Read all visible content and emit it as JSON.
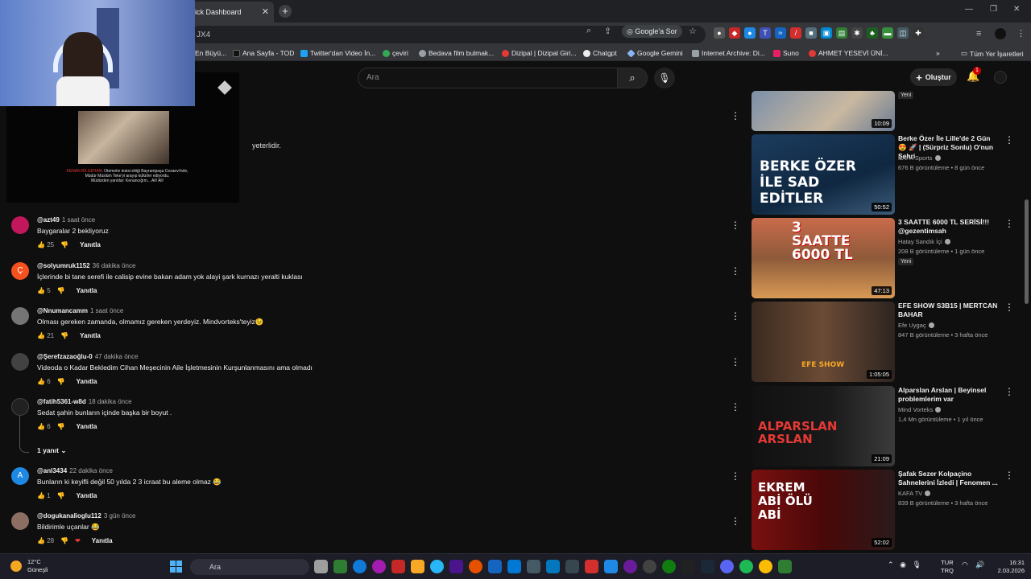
{
  "browser": {
    "tab_title": "ick Dashboard",
    "address": "JX4",
    "ask_google": "Google'a Sor",
    "bookmarks": [
      {
        "label": "En Büyü...",
        "color": "#4285f4"
      },
      {
        "label": "Ana Sayfa - TOD",
        "color": "#111111"
      },
      {
        "label": "Twitter'dan Video İn...",
        "color": "#1da1f2"
      },
      {
        "label": "çeviri",
        "color": "#34a853"
      },
      {
        "label": "Bedava film bulmak...",
        "color": "#9aa0a6"
      },
      {
        "label": "Dizipal | Dizipal Giri...",
        "color": "#e53935"
      },
      {
        "label": "Chatgpt",
        "color": "#ffffff"
      },
      {
        "label": "Google Gemini",
        "color": "#8ab4f8"
      },
      {
        "label": "Internet Archive: Di...",
        "color": "#9aa0a6"
      },
      {
        "label": "Suno",
        "color": "#e91e63"
      },
      {
        "label": "AHMET YESEVİ ÜNİ...",
        "color": "#e53935"
      }
    ],
    "all_bookmarks": "Tüm Yer İşaretleri"
  },
  "youtube": {
    "search_placeholder": "Ara",
    "create_label": "Oluştur",
    "notification_count": "1",
    "peek_text": "yeterlidir."
  },
  "mini_player": {
    "subtitle_name": "KENAN BİLGEHAN",
    "subtitle_line1": ": Otomotiv tesisi ettiği Bayrampaşa Cezaevi'nde,",
    "subtitle_line2": "Müdür Müslüm Teke'yi arayıp küfürler ediyordu.",
    "subtitle_line3": "Müdürden yanıtlar: Kenancığım... Ali! Ali!"
  },
  "comments": [
    {
      "author": "@azt49",
      "time": "1 saat önce",
      "text": "Baygaralar 2 bekliyoruz",
      "likes": "25",
      "avatar": "#c2185b",
      "initial": ""
    },
    {
      "author": "@solyumruk1152",
      "time": "36 dakika önce",
      "text": "İçlerinde bi tane serefi ile calisip evine bakan adam yok alayi şark kurnazı yeralti kuklası",
      "likes": "5",
      "avatar": "#f4511e",
      "initial": "Ç"
    },
    {
      "author": "@Nnumancamm",
      "time": "1 saat önce",
      "text": "Olması gereken zamanda, olmamız gereken yerdeyiz. Mindvorteks'teyiz😉",
      "likes": "21",
      "avatar": "#757575",
      "initial": ""
    },
    {
      "author": "@Şerefzazaoğlu-0",
      "time": "47 dakika önce",
      "text": "Videoda o Kadar Bekledim Cihan Meşecinin Aile İşletmesinin Kurşunlanmasını ama olmadı",
      "likes": "6",
      "avatar": "#424242",
      "initial": ""
    },
    {
      "author": "@fatih5361-w8d",
      "time": "18 dakika önce",
      "text": "Sedat şahin bunların içinde başka bir boyut .",
      "likes": "6",
      "avatar": "#212121",
      "initial": ""
    },
    {
      "author": "@anl3434",
      "time": "22 dakika önce",
      "text": "Bunların ki keyifli değil 50 yılda 2 3 icraat bu aleme olmaz 😂",
      "likes": "1",
      "avatar": "#1e88e5",
      "initial": "A"
    },
    {
      "author": "@dogukanalioglu112",
      "time": "3 gün önce",
      "text": "Bildirimle uçanlar 😂",
      "likes": "28",
      "avatar": "#8d6e63",
      "initial": ""
    }
  ],
  "replies_toggle": "1 yanıt",
  "reply_label": "Yanıtla",
  "recommendations": [
    {
      "title": "",
      "channel": "",
      "meta": "",
      "duration": "10:09",
      "badge": "Yeni"
    },
    {
      "title": "Berke Özer İle Lille'de 2 Gün 😍 🚀 | (Sürpriz Sonlu) O'nun Şehri",
      "channel": "KAFA Sports",
      "meta": "676 B görüntüleme • 8 gün önce",
      "duration": "50:52",
      "badge": "",
      "thumb_text": "BERKE ÖZER İLE SAD EDİTLER"
    },
    {
      "title": "3 SAATTE 6000 TL SERİSİ!!! @gezentimsah",
      "channel": "Hatay Sandık İçi",
      "meta": "208 B görüntüleme • 1 gün önce",
      "duration": "47:13",
      "badge": "Yeni",
      "thumb_text": "3 SAATTE 6000 TL"
    },
    {
      "title": "EFE SHOW S3B15 | MERTCAN BAHAR",
      "channel": "Efe Uygaç",
      "meta": "847 B görüntüleme • 3 hafta önce",
      "duration": "1:05:05",
      "badge": "",
      "thumb_text": "EFE SHOW"
    },
    {
      "title": "Alparslan Arslan | Beyinsel problemlerim var",
      "channel": "Mind Vorteks",
      "meta": "1,4 Mn görüntüleme • 1 yıl önce",
      "duration": "21:09",
      "badge": "",
      "thumb_text": "ALPARSLAN ARSLAN"
    },
    {
      "title": "Şafak Sezer Kolpaçino Sahnelerini İzledi | Fenomen ...",
      "channel": "KAFA TV",
      "meta": "839 B görüntüleme • 3 hafta önce",
      "duration": "52:02",
      "badge": "",
      "thumb_text": "EKREM ABİ ÖLÜ ABİ"
    }
  ],
  "taskbar": {
    "temp": "12°C",
    "weather": "Güneşli",
    "search": "Ara",
    "lang1": "TUR",
    "lang2": "TRQ",
    "time": "16:31",
    "date": "2.03.2026"
  }
}
